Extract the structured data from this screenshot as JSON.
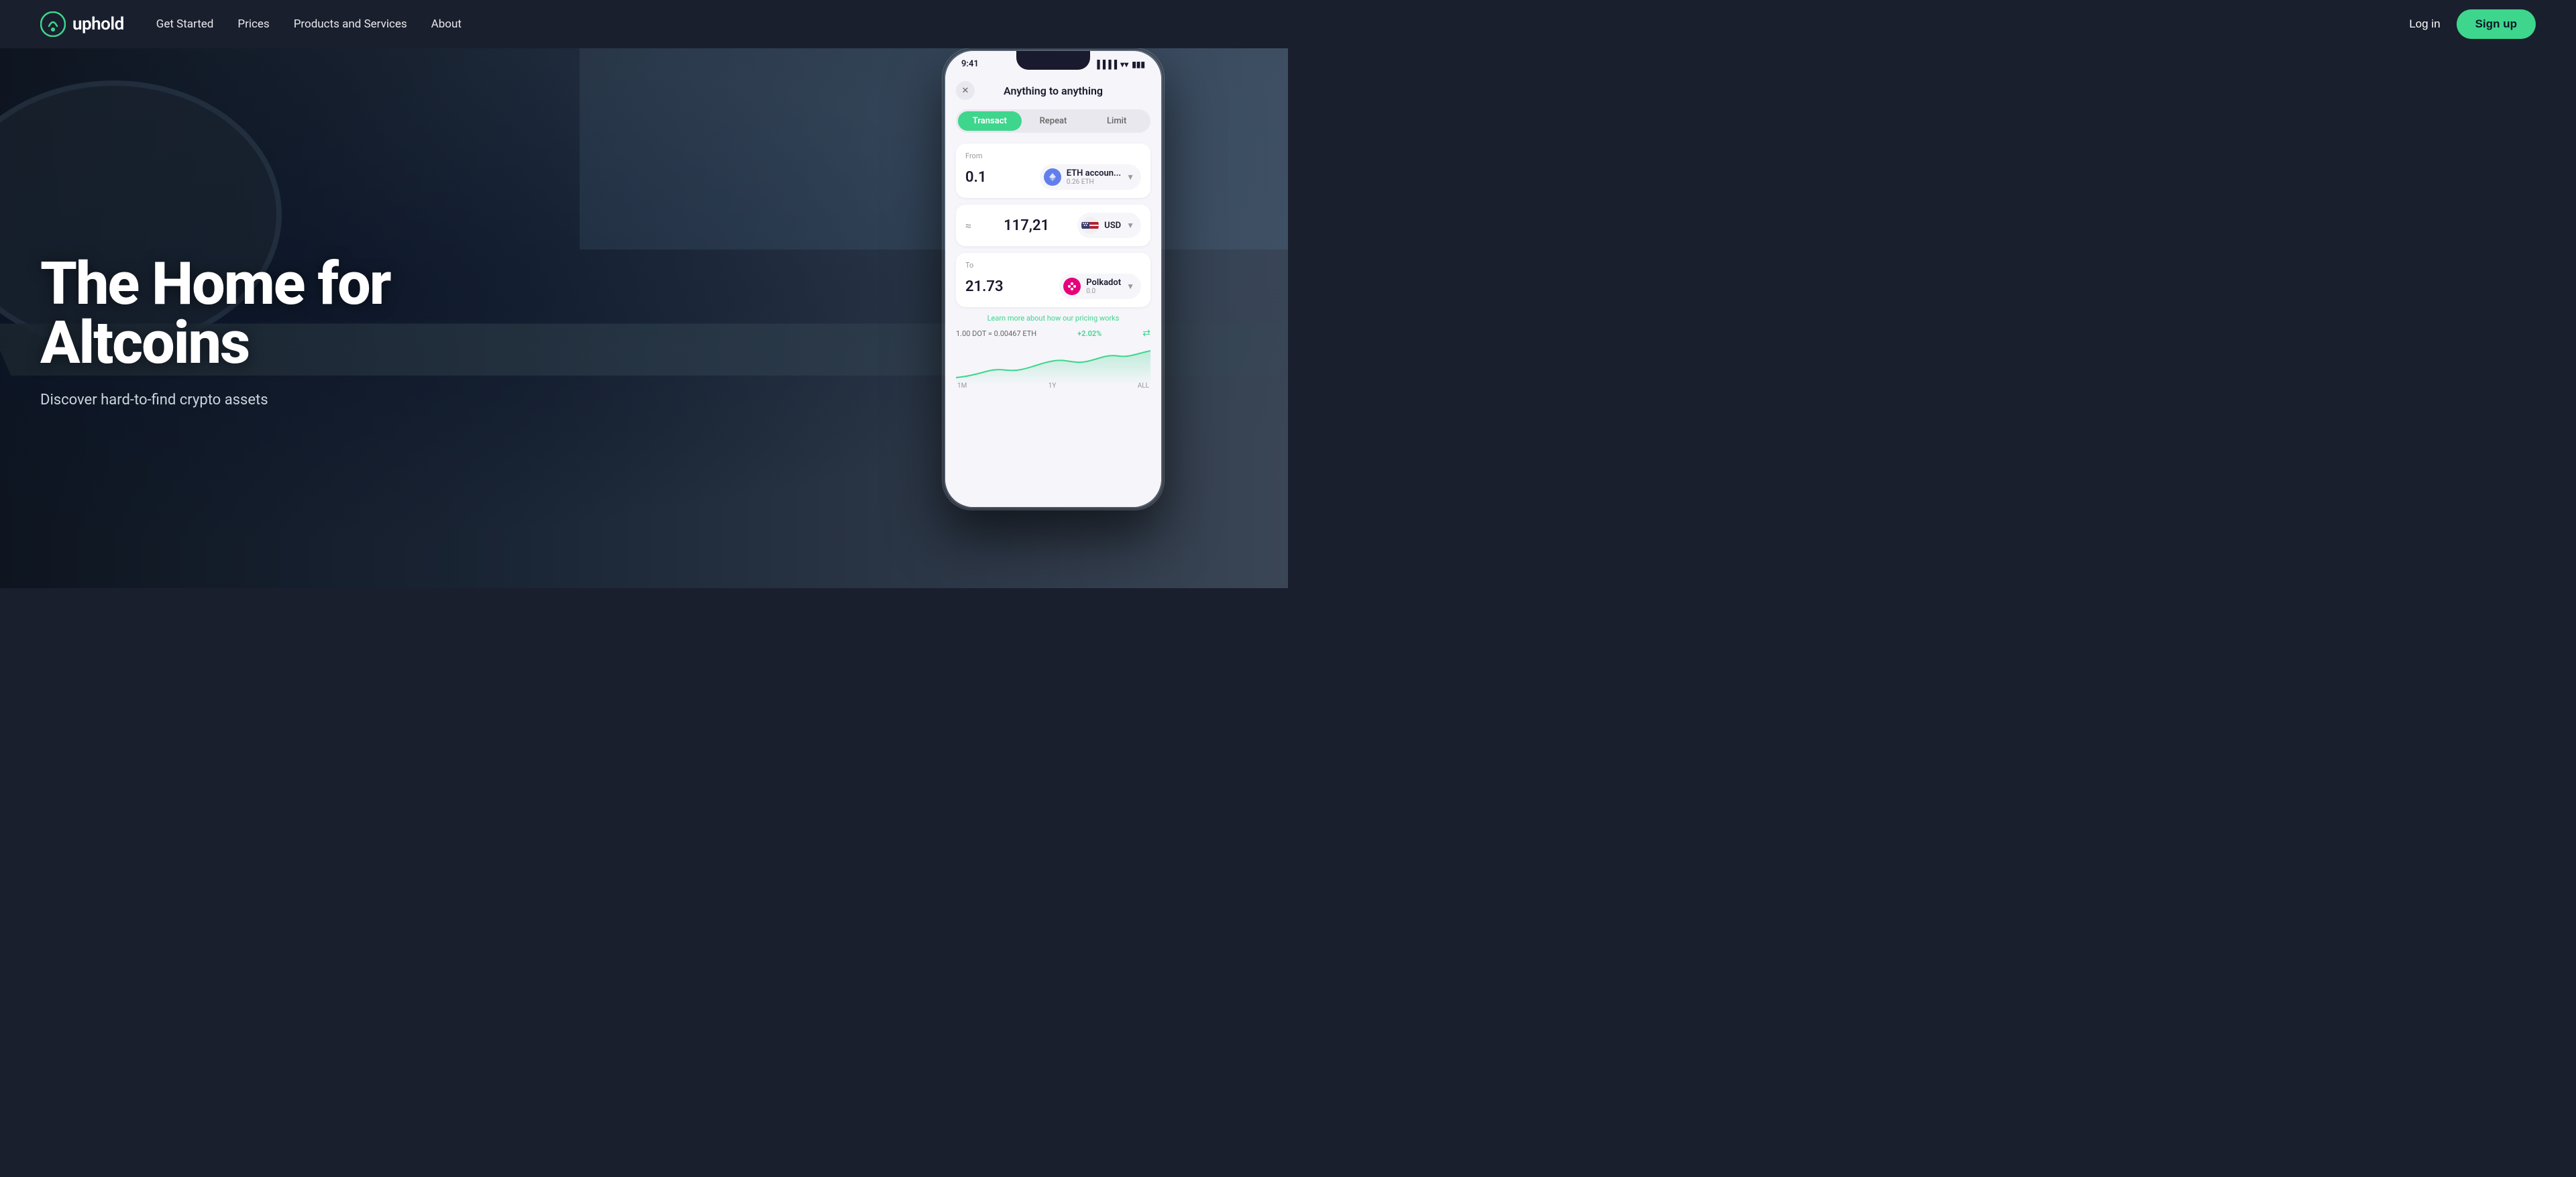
{
  "nav": {
    "logo_text": "uphold",
    "links": [
      {
        "id": "get-started",
        "label": "Get Started"
      },
      {
        "id": "prices",
        "label": "Prices"
      },
      {
        "id": "products-services",
        "label": "Products and Services"
      },
      {
        "id": "about",
        "label": "About"
      }
    ],
    "login_label": "Log in",
    "signup_label": "Sign up"
  },
  "hero": {
    "title_line1": "The Home for",
    "title_line2": "Altcoins",
    "subtitle": "Discover hard-to-find crypto assets"
  },
  "phone": {
    "status_time": "9:41",
    "app_title": "Anything to anything",
    "tabs": [
      {
        "id": "transact",
        "label": "Transact",
        "active": true
      },
      {
        "id": "repeat",
        "label": "Repeat",
        "active": false
      },
      {
        "id": "limit",
        "label": "Limit",
        "active": false
      }
    ],
    "from": {
      "label": "From",
      "amount": "0.1",
      "asset_name": "ETH accoun...",
      "asset_balance": "0.26 ETH"
    },
    "middle_amount": "117,21",
    "middle_asset": "USD",
    "to": {
      "label": "To",
      "amount": "21.73",
      "asset_name": "Polkadot",
      "asset_balance": "0.0"
    },
    "pricing_link": "Learn more about how our pricing works",
    "rate": "1.00 DOT = 0.00467 ETH",
    "rate_change": "+2.02%",
    "chart_labels": [
      "1M",
      "1Y",
      "ALL"
    ]
  },
  "colors": {
    "nav_bg": "#1a1f2e",
    "green_accent": "#3dd68c",
    "white": "#ffffff"
  }
}
